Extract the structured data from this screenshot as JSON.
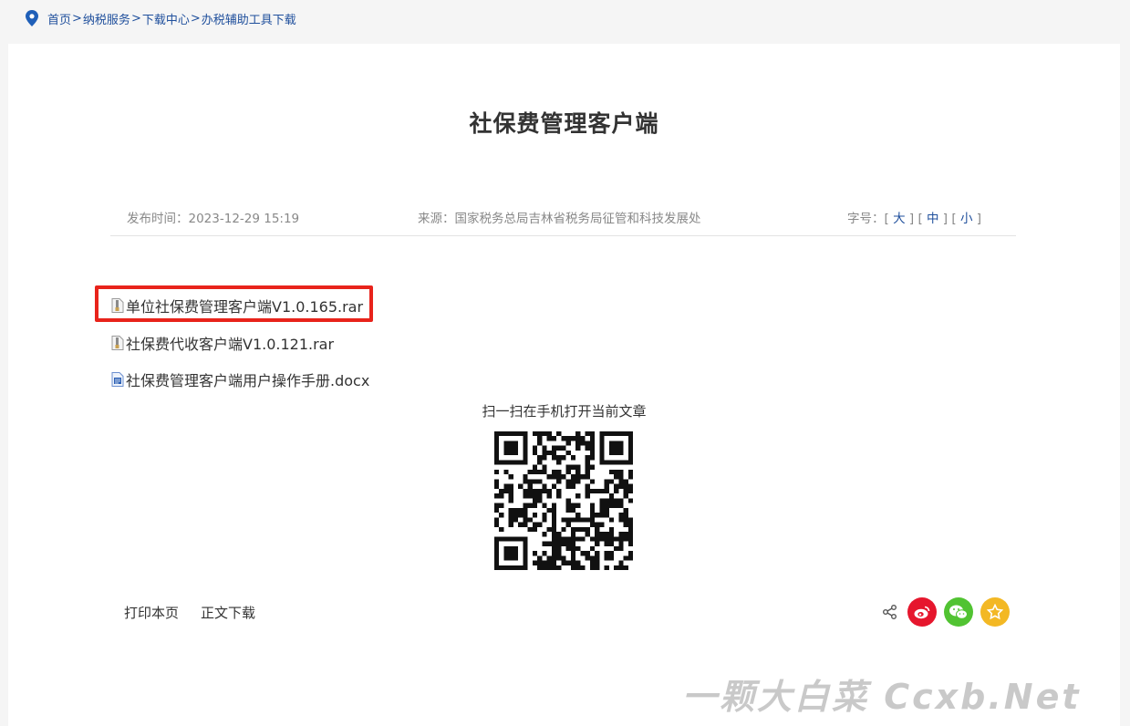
{
  "breadcrumb": {
    "items": [
      "首页",
      "纳税服务",
      "下载中心",
      "办税辅助工具下载"
    ],
    "separator": ">"
  },
  "article": {
    "title": "社保费管理客户端",
    "publish_label": "发布时间：2023-12-29 15:19",
    "source_label": "来源：国家税务总局吉林省税务局征管和科技发展处",
    "font_size": {
      "label": "字号：",
      "large": "大",
      "medium": "中",
      "small": "小"
    }
  },
  "attachments": [
    {
      "name": "单位社保费管理客户端V1.0.165.rar",
      "icon": "rar-file-icon"
    },
    {
      "name": "社保费代收客户端V1.0.121.rar",
      "icon": "rar-file-icon"
    },
    {
      "name": "社保费管理客户端用户操作手册.docx",
      "icon": "doc-file-icon"
    }
  ],
  "qr": {
    "caption": "扫一扫在手机打开当前文章"
  },
  "footer_actions": {
    "print": "打印本页",
    "download": "正文下载"
  },
  "share": {
    "icons": [
      "share-icon",
      "weibo-icon",
      "wechat-icon",
      "favorite-icon"
    ],
    "colors": {
      "weibo": "#e6162d",
      "wechat": "#51c332",
      "favorite": "#f3b824"
    }
  },
  "watermark": "一颗大白菜 Ccxb.Net",
  "colors": {
    "link": "#1f4f9c",
    "highlight": "#e8231b",
    "background": "#f5f5f5"
  }
}
